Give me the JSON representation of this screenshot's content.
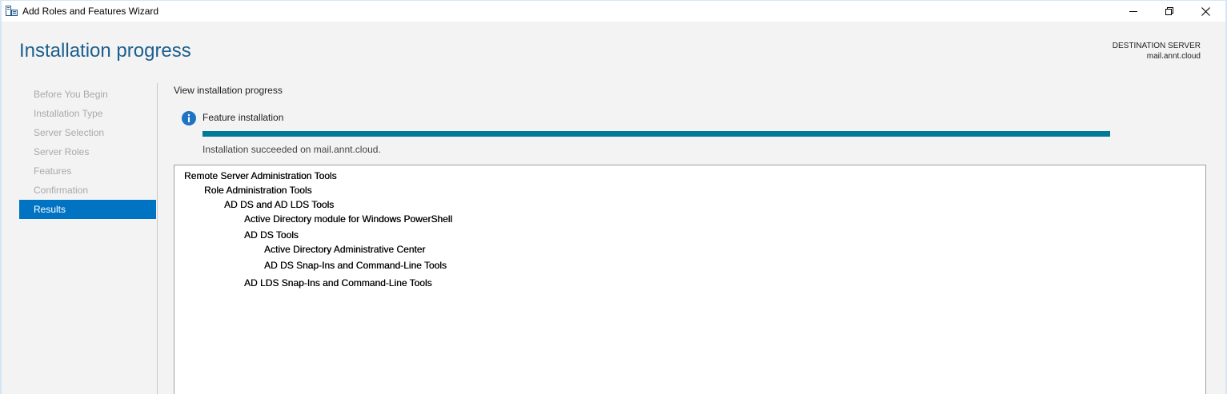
{
  "window": {
    "title": "Add Roles and Features Wizard",
    "icon": "server-manager-icon"
  },
  "header": {
    "title": "Installation progress",
    "destination_label": "DESTINATION SERVER",
    "destination_value": "mail.annt.cloud"
  },
  "nav": {
    "items": [
      {
        "label": "Before You Begin",
        "active": false
      },
      {
        "label": "Installation Type",
        "active": false
      },
      {
        "label": "Server Selection",
        "active": false
      },
      {
        "label": "Server Roles",
        "active": false
      },
      {
        "label": "Features",
        "active": false
      },
      {
        "label": "Confirmation",
        "active": false
      },
      {
        "label": "Results",
        "active": true
      }
    ]
  },
  "main": {
    "heading": "View installation progress",
    "feature_label": "Feature installation",
    "progress_percent": 100,
    "status": "Installation succeeded on mail.annt.cloud.",
    "results": [
      {
        "label": "Remote Server Administration Tools",
        "level": 0
      },
      {
        "label": "Role Administration Tools",
        "level": 1
      },
      {
        "label": "AD DS and AD LDS Tools",
        "level": 2
      },
      {
        "label": "Active Directory module for Windows PowerShell",
        "level": 3
      },
      {
        "label": "AD DS Tools",
        "level": 3
      },
      {
        "label": "Active Directory Administrative Center",
        "level": 4
      },
      {
        "label": "AD DS Snap-Ins and Command-Line Tools",
        "level": 4
      },
      {
        "label": "AD LDS Snap-Ins and Command-Line Tools",
        "level": 3
      }
    ]
  },
  "colors": {
    "accent": "#0074c3",
    "heading": "#1c5f8e",
    "progress": "#007a96"
  }
}
